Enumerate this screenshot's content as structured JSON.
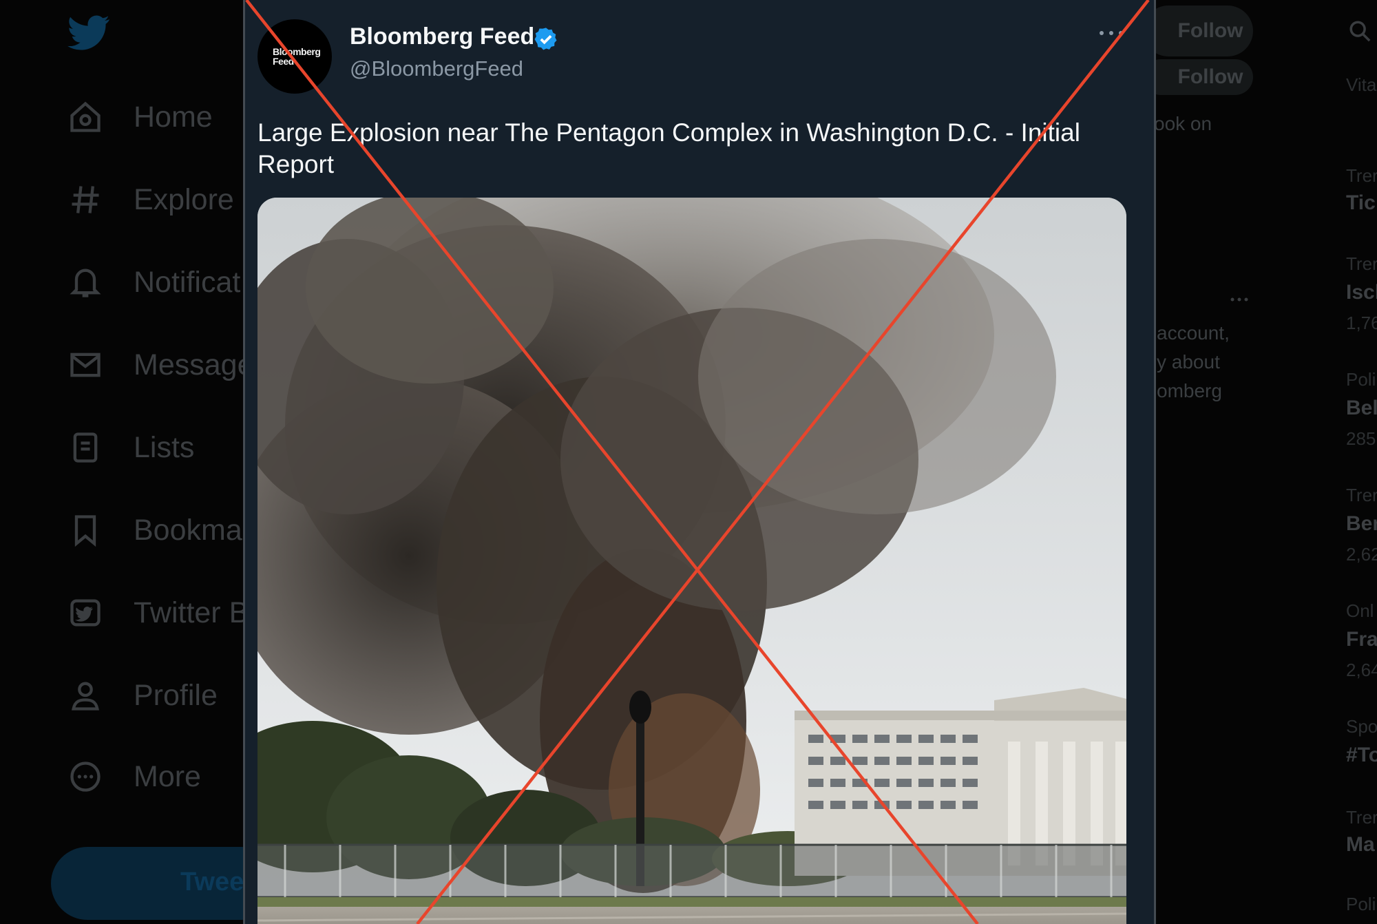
{
  "sidebar": {
    "logo_icon": "twitter-bird-icon",
    "nav": [
      {
        "label": "Home",
        "icon": "home-icon"
      },
      {
        "label": "Explore",
        "icon": "hashtag-icon"
      },
      {
        "label": "Notificat",
        "icon": "bell-icon"
      },
      {
        "label": "Message",
        "icon": "envelope-icon"
      },
      {
        "label": "Lists",
        "icon": "list-icon"
      },
      {
        "label": "Bookma",
        "icon": "bookmark-icon"
      },
      {
        "label": "Twitter B",
        "icon": "twitter-blue-icon"
      },
      {
        "label": "Profile",
        "icon": "person-icon"
      },
      {
        "label": "More",
        "icon": "more-circle-icon"
      }
    ],
    "tweet_button": "Twee"
  },
  "right_column": {
    "follow_1": "Follow",
    "follow_2": "Follow",
    "profile_snippet_1": "ook on",
    "bio_lines": [
      "account,",
      "y about",
      "omberg"
    ],
    "trends": [
      {
        "category": "Vita",
        "title": "",
        "count": ""
      },
      {
        "category": "Trer",
        "title": "Tic",
        "count": ""
      },
      {
        "category": "Trer",
        "title": "Isch",
        "count": "1,76"
      },
      {
        "category": "Poli",
        "title": "Bel",
        "count": "285"
      },
      {
        "category": "Trer",
        "title": "Ber",
        "count": "2,62"
      },
      {
        "category": "Onl",
        "title": "Fra",
        "count": "2,64"
      },
      {
        "category": "Spo",
        "title": "#To",
        "count": ""
      },
      {
        "category": "Trer",
        "title": "Ma",
        "count": ""
      },
      {
        "category": "Poli",
        "title": "",
        "count": ""
      }
    ]
  },
  "tweet": {
    "avatar_text": [
      "Bloomberg",
      "Feed"
    ],
    "display_name": "Bloomberg Feed",
    "handle": "@BloombergFeed",
    "text": "Large Explosion near The Pentagon Complex in Washington D.C. - Initial Report",
    "verified_icon": "verified-badge-icon",
    "menu_icon": "more-horizontal-icon"
  },
  "colors": {
    "card_bg": "#15202b",
    "verified": "#1d9bf0",
    "cross_mark": "#e8452c"
  }
}
